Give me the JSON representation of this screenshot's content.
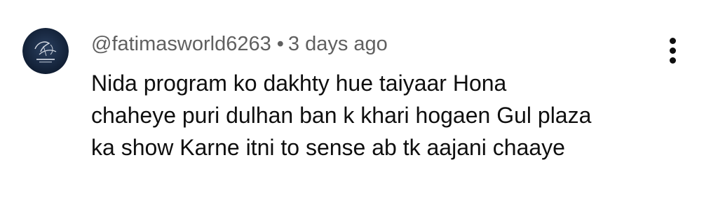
{
  "comment": {
    "author": "@fatimasworld6263",
    "separator": "•",
    "timestamp": "3 days ago",
    "text_lines": [
      "Nida program ko dakhty hue taiyaar Hona",
      "chaheye puri dulhan ban k khari hogaen Gul plaza",
      "ka show Karne itni to sense ab tk aajani chaaye"
    ],
    "avatar_icon": "channel-avatar-logo",
    "menu_icon": "more-vertical-icon"
  },
  "colors": {
    "meta_text": "#606060",
    "body_text": "#0f0f0f",
    "avatar_bg": "#15253e",
    "background": "#ffffff"
  }
}
